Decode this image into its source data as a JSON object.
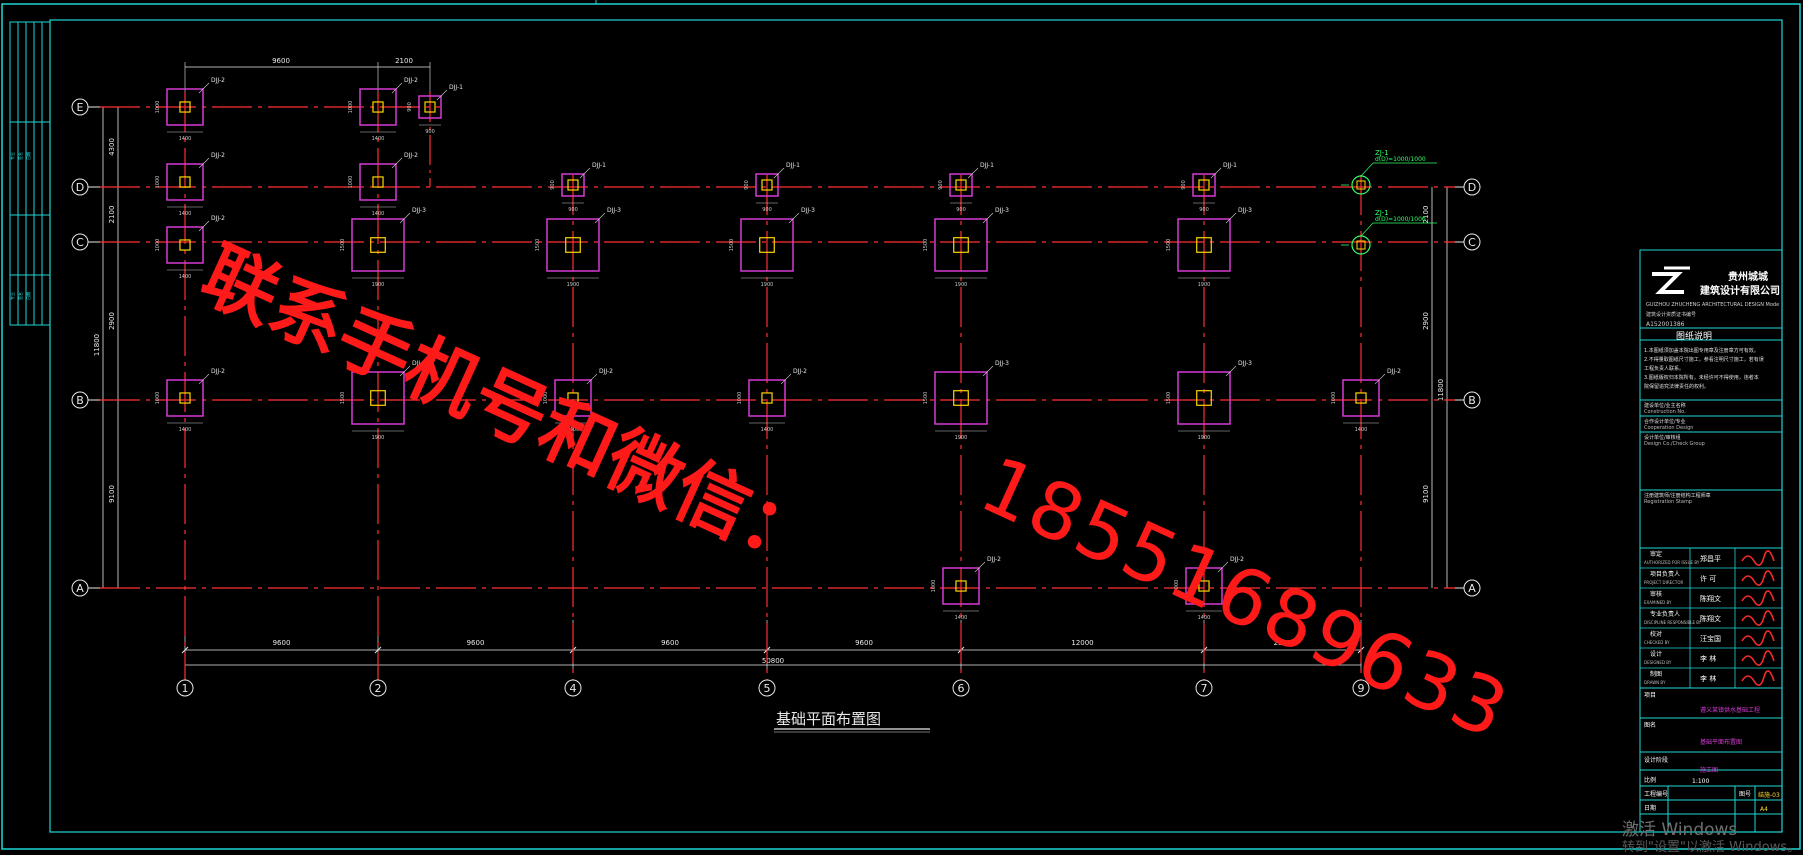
{
  "drawing": {
    "title": "基础平面布置图",
    "total_dim": "50800",
    "row_labels": [
      "E",
      "D",
      "C",
      "B",
      "A"
    ],
    "col_labels": [
      "1",
      "2",
      "4",
      "5",
      "6",
      "7",
      "9"
    ],
    "span_dims_bottom": [
      "9600",
      "9600",
      "9600",
      "9600",
      "12000",
      "2900"
    ],
    "span_dims_top": [
      "9600",
      "2100"
    ],
    "left_dims": [
      "4300",
      "2100",
      "2900",
      "11800",
      "9100"
    ],
    "right_dims": [
      "2100",
      "2900",
      "11800",
      "9100"
    ],
    "footings": [
      {
        "tag": "DJJ-2",
        "w": "1400",
        "h": "1000"
      },
      {
        "tag": "DJJ-1",
        "w": "900",
        "h": "900"
      },
      {
        "tag": "DJJ-3",
        "w": "1900",
        "h": "1500"
      }
    ],
    "columns_zj": [
      {
        "tag": "ZJ-1",
        "spec": "d(D)=1000/1000"
      },
      {
        "tag": "ZJ-1",
        "spec": "d(D)=1000/1000"
      }
    ]
  },
  "title_block": {
    "company_cn": "贵州城城",
    "company_cn2": "建筑设计有限公司",
    "company_en": "GUIZHOU ZHUCHENG ARCHITECTURAL DESIGN Mode",
    "cert_label": "建筑设计资质证书编号",
    "cert_no": "A152001386",
    "notes_title": "图纸说明",
    "notes": [
      "1.本图纸须加盖本院出图专用章及注册章方可有效。",
      "2.不得量取图纸尺寸施工，参看注明尺寸施工，若有误",
      "  工程负责人联系。",
      "3.图纸版权归本院所有，未经许可不得使用，违者本",
      "  院保留追究法律责任的权利。"
    ],
    "rows": [
      {
        "cn": "建设单位/业主名称",
        "en": "Construction No."
      },
      {
        "cn": "合作设计单位/专业",
        "en": "Cooperation Design"
      },
      {
        "cn": "设计单位/审核组",
        "en": "Design Co./Check Group"
      },
      {
        "cn": "注册建筑师/注册结构工程师章",
        "en": "Registration Stamp"
      }
    ],
    "sign_rows": [
      {
        "role": "审定",
        "en": "AUTHORIZED FOR ISSUE BY",
        "name": "郑昌平"
      },
      {
        "role": "项目负责人",
        "en": "PROJECT DIRECTOR",
        "name": "许 可"
      },
      {
        "role": "审核",
        "en": "EXAMINED BY",
        "name": "陈翔文"
      },
      {
        "role": "专业负责人",
        "en": "DISCIPLINE RESPONSIBLE BY",
        "name": "陈翔文"
      },
      {
        "role": "校对",
        "en": "CHECKED BY",
        "name": "汪宝国"
      },
      {
        "role": "设计",
        "en": "DESIGNED BY",
        "name": "李 林"
      },
      {
        "role": "制图",
        "en": "DRAWN BY",
        "name": "李 林"
      }
    ],
    "project_label": "项目",
    "project_name": "遵义某镇供水基础工程",
    "drawing_label": "图名",
    "drawing_name": "基础平面布置图",
    "stage_label": "设计阶段",
    "stage_value": "施工图",
    "scale_label": "比例",
    "scale_value": "1:100",
    "job_label": "工程编号",
    "sheet_label": "图号",
    "sheet_value": "结施-03",
    "date_label": "日期",
    "date_value": "A4"
  },
  "watermark": {
    "text_cn": "联系手机号和微信：",
    "text_phone": "18551689633"
  },
  "os_overlay": {
    "line1": "激活 Windows",
    "line2": "转到\"设置\"以激活 Windows。"
  },
  "colors": {
    "background": "#000000",
    "frame": "#1fd6d6",
    "axis": "#ff3030",
    "footing": "#d63bd6",
    "column": "#ffd700",
    "dim": "#e8e8e8"
  }
}
